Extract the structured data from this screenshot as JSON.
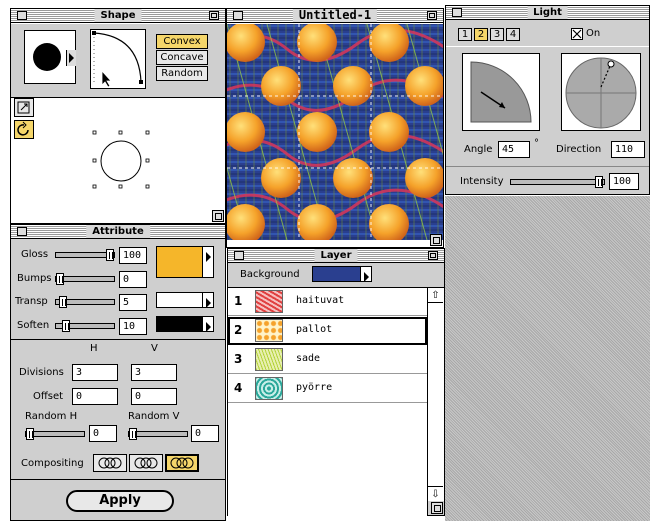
{
  "shape_window": {
    "title": "Shape",
    "buttons": [
      "Convex",
      "Concave",
      "Random"
    ]
  },
  "attribute_window": {
    "title": "Attribute",
    "rows": [
      {
        "label": "Gloss",
        "value": "100",
        "slider": 0.95
      },
      {
        "label": "Bumps",
        "value": "0",
        "slider": 0.0
      },
      {
        "label": "Transp",
        "value": "5",
        "slider": 0.05
      },
      {
        "label": "Soften",
        "value": "10",
        "slider": 0.1
      }
    ],
    "colors": {
      "gloss": "#f5b62a",
      "bumps": "#ffffff",
      "transp": "#000000"
    },
    "col_h": "H",
    "col_v": "V",
    "divisions_label": "Divisions",
    "divisions_h": "3",
    "divisions_v": "3",
    "offset_label": "Offset",
    "offset_h": "0",
    "offset_v": "0",
    "random_h_label": "Random H",
    "random_v_label": "Random V",
    "random_h_value": "0",
    "random_v_value": "0",
    "compositing_label": "Compositing",
    "apply_label": "Apply"
  },
  "document_window": {
    "title": "Untitled-1"
  },
  "layer_window": {
    "title": "Layer",
    "background_label": "Background",
    "background_color": "#2a3f8f",
    "layers": [
      {
        "num": "1",
        "name": "haituvat",
        "thumb": "red"
      },
      {
        "num": "2",
        "name": "pallot",
        "thumb": "orange"
      },
      {
        "num": "3",
        "name": "sade",
        "thumb": "yellowgreen"
      },
      {
        "num": "4",
        "name": "pyörre",
        "thumb": "teal"
      }
    ],
    "selected_layer": "2"
  },
  "light_window": {
    "title": "Light",
    "tabs": [
      "1",
      "2",
      "3",
      "4"
    ],
    "selected_tab": "2",
    "on_label": "On",
    "on_checked": true,
    "angle_label": "Angle",
    "angle_value": "45",
    "angle_unit": "°",
    "direction_label": "Direction",
    "direction_value": "110",
    "intensity_label": "Intensity",
    "intensity_value": "100",
    "intensity_level": 0.95
  }
}
